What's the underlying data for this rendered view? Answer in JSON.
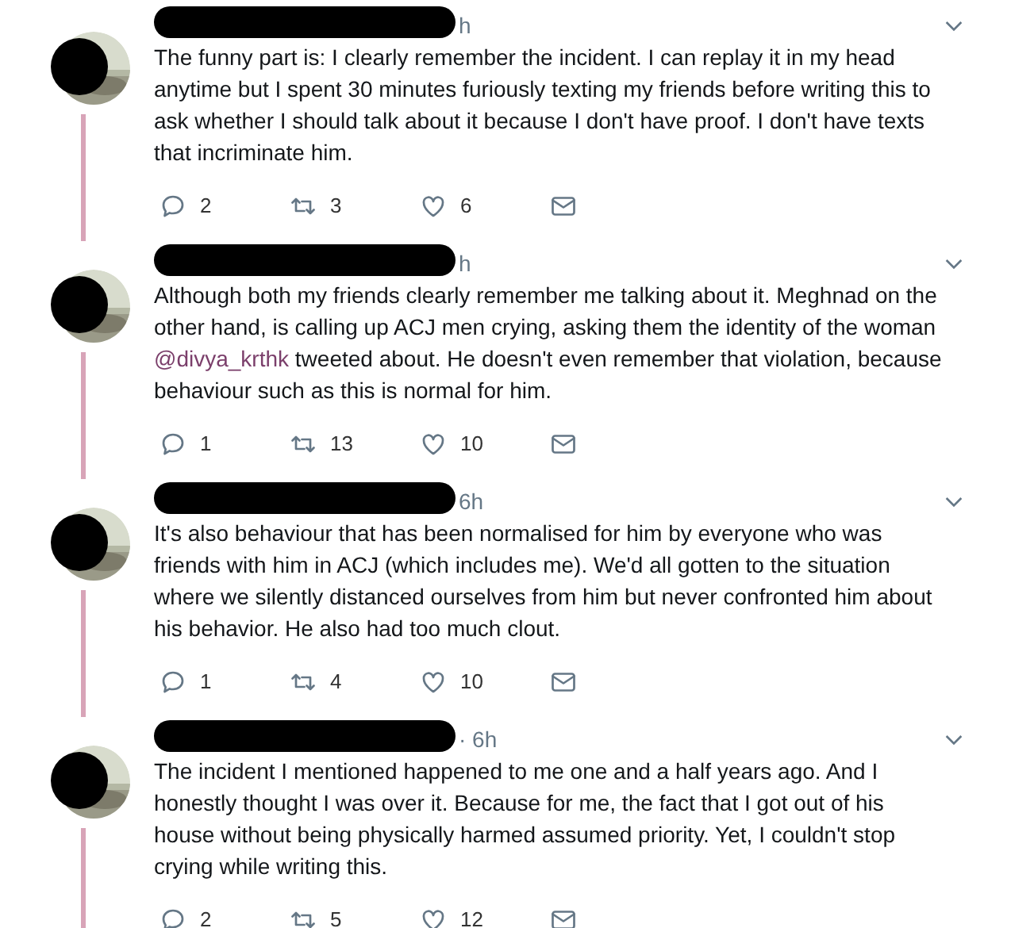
{
  "tweets": [
    {
      "time": "h",
      "text": "The funny part is: I clearly remember the incident. I can replay it in my head anytime  but I spent 30 minutes furiously texting my friends before writing this to ask whether I should talk about it because I don't have proof. I don't have texts that incriminate him.",
      "replies": "2",
      "retweets": "3",
      "likes": "6"
    },
    {
      "time": "h",
      "segments": [
        {
          "kind": "text",
          "text": "Although both my friends clearly remember me talking about it. Meghnad on the other hand, is calling up ACJ men crying, asking them the identity of the woman "
        },
        {
          "kind": "mention",
          "text": "@divya_krthk"
        },
        {
          "kind": "text",
          "text": " tweeted about. He doesn't even remember that violation, because behaviour such as this is normal for him."
        }
      ],
      "replies": "1",
      "retweets": "13",
      "likes": "10"
    },
    {
      "time": "6h",
      "text": "It's also behaviour that has been normalised for him by everyone who was friends with him in ACJ (which includes me). We'd all gotten to the situation where we silently distanced ourselves from him but never confronted him about his behavior. He also had too much clout.",
      "replies": "1",
      "retweets": "4",
      "likes": "10"
    },
    {
      "time": "· 6h",
      "text": "The incident I mentioned happened to me one and a half years ago. And I honestly thought I was over it. Because for me, the fact that I got out of his house without being physically harmed assumed priority. Yet, I couldn't stop crying while writing this.",
      "replies": "2",
      "retweets": "5",
      "likes": "12"
    }
  ]
}
